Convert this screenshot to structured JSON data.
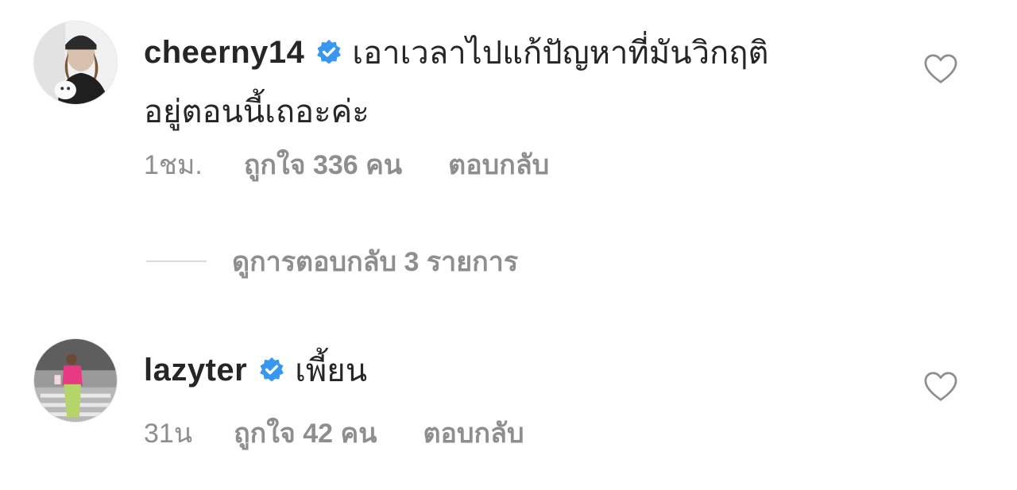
{
  "comments": [
    {
      "username": "cheerny14",
      "verified": true,
      "text_line1": "เอาเวลาไปแก้ปัญหาที่มันวิกฤติ",
      "text_line2": "อยู่ตอนนี้เถอะค่ะ",
      "time": "1ชม.",
      "likes": "ถูกใจ 336 คน",
      "reply": "ตอบกลับ",
      "view_replies": "ดูการตอบกลับ 3 รายการ"
    },
    {
      "username": "lazyter",
      "verified": true,
      "text_line1": "เพี้ยน",
      "time": "31น",
      "likes": "ถูกใจ 42 คน",
      "reply": "ตอบกลับ"
    }
  ],
  "icons": {
    "verified": "verified-badge-icon",
    "like": "heart-icon"
  },
  "colors": {
    "verified_blue": "#3897f0",
    "text_primary": "#262626",
    "text_secondary": "#8e8e8e"
  }
}
